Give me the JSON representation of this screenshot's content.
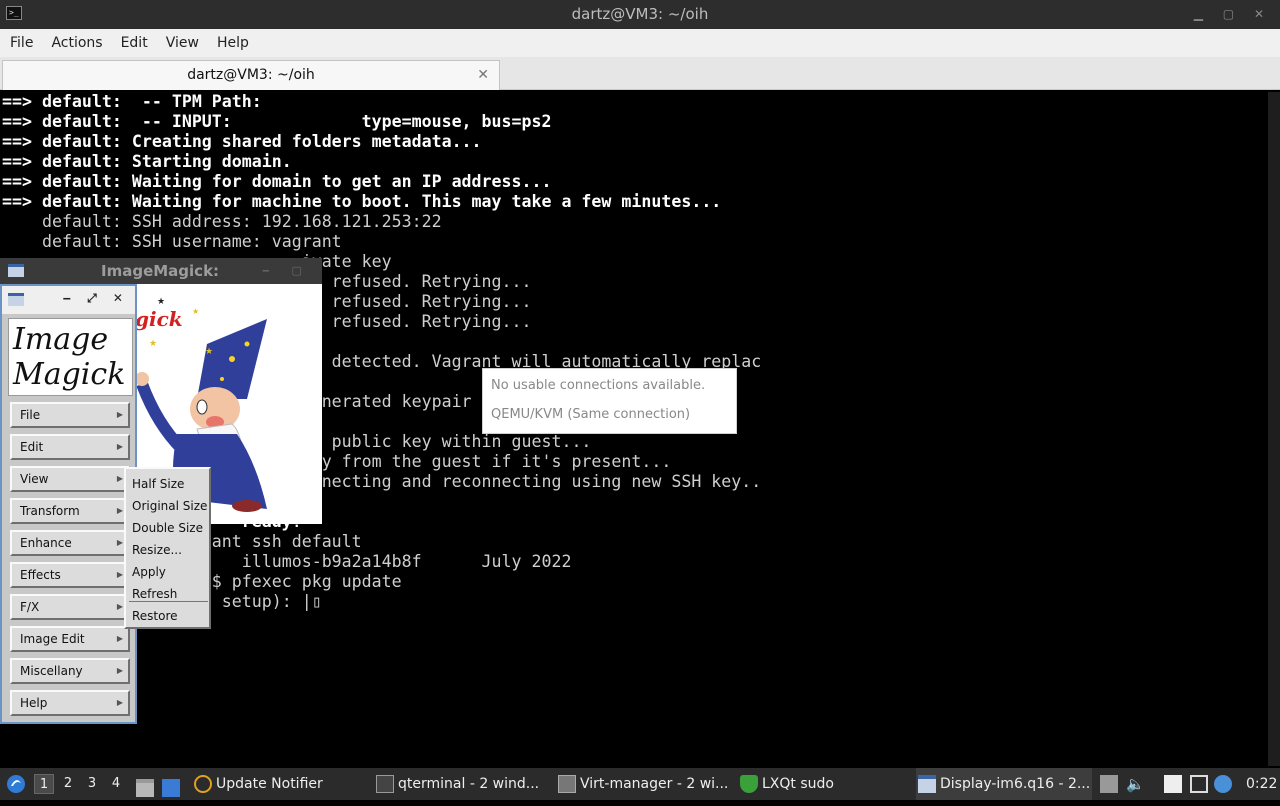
{
  "terminal": {
    "window_title": "dartz@VM3: ~/oih",
    "window_buttons": "▁ ▢ ✕",
    "menu": [
      "File",
      "Actions",
      "Edit",
      "View",
      "Help"
    ],
    "tab_label": "dartz@VM3: ~/oih",
    "tab_close": "✕",
    "lines": [
      {
        "text": "==> default:  -- TPM Path:",
        "bold": true
      },
      {
        "text": "==> default:  -- INPUT:             type=mouse, bus=ps2",
        "bold": true
      },
      {
        "text": "==> default: Creating shared folders metadata...",
        "bold": true
      },
      {
        "text": "==> default: Starting domain.",
        "bold": true
      },
      {
        "text": "==> default: Waiting for domain to get an IP address...",
        "bold": true
      },
      {
        "text": "==> default: Waiting for machine to boot. This may take a few minutes...",
        "bold": true
      },
      {
        "text": "    default: SSH address: 192.168.121.253:22",
        "bold": false
      },
      {
        "text": "    default: SSH username: vagrant",
        "bold": false
      },
      {
        "text": "                              ivate key",
        "bold": false
      },
      {
        "text": "                                 refused. Retrying...",
        "bold": false
      },
      {
        "text": "                                 refused. Retrying...",
        "bold": false
      },
      {
        "text": "                                 refused. Retrying...",
        "bold": false
      },
      {
        "text": "",
        "bold": false
      },
      {
        "text": "                               y detected. Vagrant will automatically replac",
        "bold": false
      },
      {
        "text": "",
        "bold": false
      },
      {
        "text": "                               enerated keypair",
        "bold": false
      },
      {
        "text": "",
        "bold": false
      },
      {
        "text": "                                 public key within guest...",
        "bold": false
      },
      {
        "text": "                               ey from the guest if it's present...",
        "bold": false
      },
      {
        "text": "                               nnecting and reconnecting using new SSH key..",
        "bold": false
      },
      {
        "text": "",
        "bold": false
      },
      {
        "text": "                        ready!",
        "bold": true
      },
      {
        "text": "                     ant ssh default",
        "bold": false
      },
      {
        "text": "                        illumos-b9a2a14b8f      July 2022",
        "bold": false
      },
      {
        "text": "                     $ pfexec pkg update",
        "bold": false
      },
      {
        "text": "                      setup): |▯",
        "bold": false
      }
    ]
  },
  "imagemagick": {
    "display_title": "ImageMagick:",
    "display_buttons": "‒ ▢ ✕",
    "command_buttons_title": "‒ ⤢ ✕",
    "logo_line1": "Image",
    "logo_line2": "Magick",
    "image_caption": "gick",
    "menu_buttons": [
      "File",
      "Edit",
      "View",
      "Transform",
      "Enhance",
      "Effects",
      "F/X",
      "Image Edit",
      "Miscellany",
      "Help"
    ],
    "view_submenu": [
      "Half Size",
      "Original Size",
      "Double Size",
      "Resize...",
      "Apply",
      "Refresh",
      "Restore"
    ]
  },
  "popup": {
    "line1": "No usable connections available.",
    "line2": "QEMU/KVM (Same connection)"
  },
  "taskbar": {
    "desktops": [
      "1",
      "2",
      "3",
      "4"
    ],
    "active_desktop": "1",
    "tasks": [
      {
        "label": "Update Notifier",
        "icon": "update-notifier-icon"
      },
      {
        "label": "qterminal - 2 wind...",
        "icon": "terminal-icon"
      },
      {
        "label": "Virt-manager - 2 wi...",
        "icon": "virt-manager-icon"
      },
      {
        "label": "LXQt sudo",
        "icon": "shield-check-icon"
      },
      {
        "label": "Display-im6.q16 - 2...",
        "icon": "window-icon"
      }
    ],
    "clock": "0:22"
  },
  "colors": {
    "terminal_bg": "#000000",
    "terminal_text": "#ffffff",
    "taskbar_bg": "#2b2b2b",
    "im_window_border": "#6c93c6"
  }
}
